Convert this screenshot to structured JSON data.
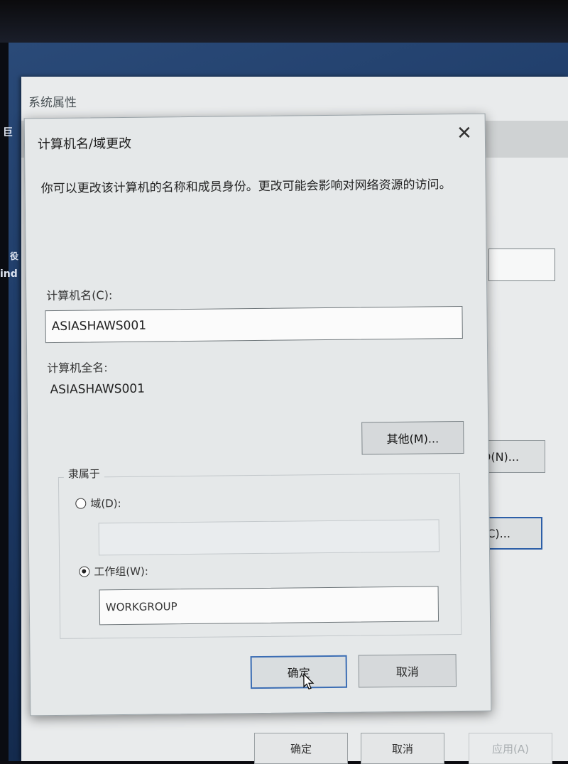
{
  "background_window": {
    "title": "系统属性",
    "button_fragment_1": "D(N)...",
    "button_fragment_2": "(C)...",
    "bottom_buttons": {
      "ok": "确定",
      "cancel": "取消",
      "apply": "应用(A)"
    }
  },
  "desktop_fragments": {
    "icon_text_1": "巨",
    "icon_text_2": "ind",
    "icon_text_3": "役"
  },
  "dialog": {
    "title": "计算机名/域更改",
    "description": "你可以更改该计算机的名称和成员身份。更改可能会影响对网络资源的访问。",
    "computer_name_label": "计算机名(C):",
    "computer_name_value": "ASIASHAWS001",
    "full_name_label": "计算机全名:",
    "full_name_value": "ASIASHAWS001",
    "more_button": "其他(M)...",
    "member_of_label": "隶属于",
    "domain_radio_label": "域(D):",
    "domain_value": "",
    "workgroup_radio_label": "工作组(W):",
    "workgroup_value": "WORKGROUP",
    "selected_membership": "workgroup",
    "ok_button": "确定",
    "cancel_button": "取消"
  }
}
